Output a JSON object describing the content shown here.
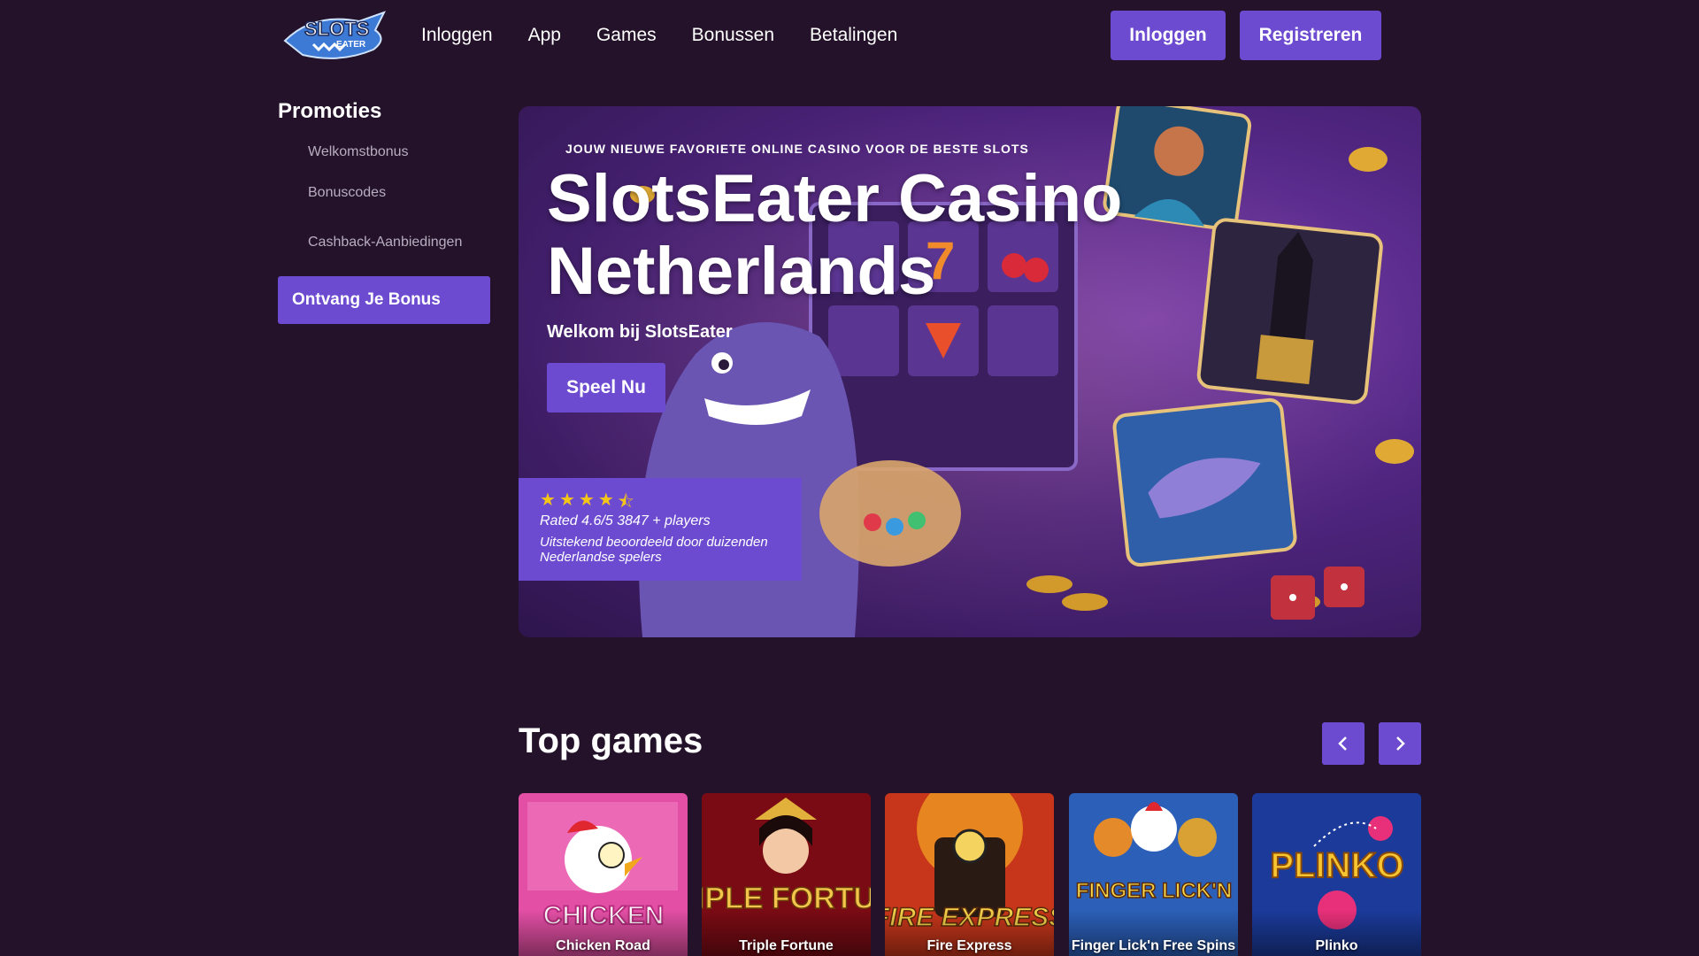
{
  "header": {
    "logo_alt": "SlotsEater",
    "nav": [
      "Inloggen",
      "App",
      "Games",
      "Bonussen",
      "Betalingen"
    ],
    "login_label": "Inloggen",
    "register_label": "Registreren"
  },
  "sidebar": {
    "title": "Promoties",
    "items": [
      "Welkomstbonus",
      "Bonuscodes",
      "Cashback-Aanbiedingen"
    ],
    "bonus_button": "Ontvang Je Bonus"
  },
  "hero": {
    "tagline": "JOUW NIEUWE FAVORIETE ONLINE CASINO VOOR DE BESTE SLOTS",
    "title": "SlotsEater Casino Netherlands",
    "subtitle": "Welkom bij SlotsEater",
    "cta": "Speel Nu",
    "rating": {
      "stars": 4.5,
      "label": "Rated",
      "score": "4.6/5",
      "players": "3847",
      "players_suffix": "+ players",
      "description": "Uitstekend beoordeeld door duizenden Nederlandse spelers"
    }
  },
  "top_games": {
    "title": "Top games",
    "prev_icon": "chevron-left-icon",
    "next_icon": "chevron-right-icon",
    "games": [
      {
        "name": "Chicken Road",
        "art_text": "CHICKEN"
      },
      {
        "name": "Triple Fortune",
        "art_text": "TRIPLE FORTUNE"
      },
      {
        "name": "Fire Express",
        "art_text": "FIRE EXPRESS"
      },
      {
        "name": "Finger Lick'n Free Spins",
        "art_text": "FINGER LICK'N"
      },
      {
        "name": "Plinko",
        "art_text": "PLINKO"
      }
    ]
  },
  "colors": {
    "background": "#231229",
    "accent": "#6c4bd1",
    "star": "#f5c518"
  }
}
